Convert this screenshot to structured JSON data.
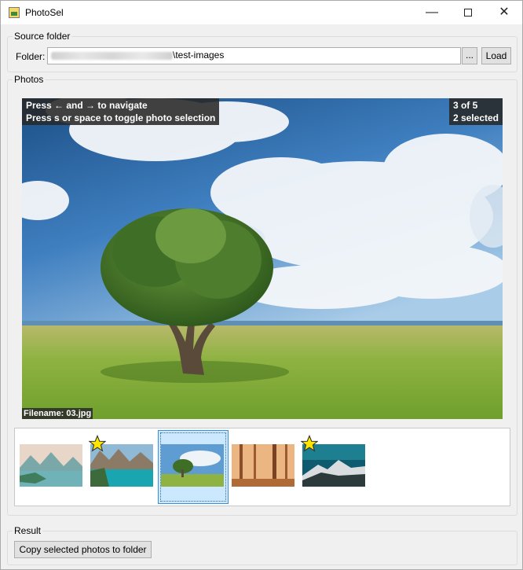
{
  "window": {
    "title": "PhotoSel",
    "min_glyph": "—",
    "close_glyph": "✕"
  },
  "source": {
    "group_label": "Source folder",
    "folder_label": "Folder:",
    "folder_value_suffix": "\\test-images",
    "browse_label": "...",
    "load_label": "Load"
  },
  "photos": {
    "group_label": "Photos",
    "hint_line1": "Press ← and  → to navigate",
    "hint_line2": "Press s or space to toggle photo selection",
    "position_line": "3  of  5",
    "selected_line": "2  selected",
    "filename": "Filename: 03.jpg",
    "thumbnails": [
      {
        "name": "thumb-1",
        "starred": false,
        "current": false
      },
      {
        "name": "thumb-2",
        "starred": true,
        "current": false
      },
      {
        "name": "thumb-3",
        "starred": false,
        "current": true
      },
      {
        "name": "thumb-4",
        "starred": false,
        "current": false
      },
      {
        "name": "thumb-5",
        "starred": true,
        "current": false
      }
    ]
  },
  "result": {
    "group_label": "Result",
    "copy_label": "Copy selected photos to folder"
  },
  "colors": {
    "selection_bg": "#cce8ff",
    "star": "#ffe600"
  }
}
